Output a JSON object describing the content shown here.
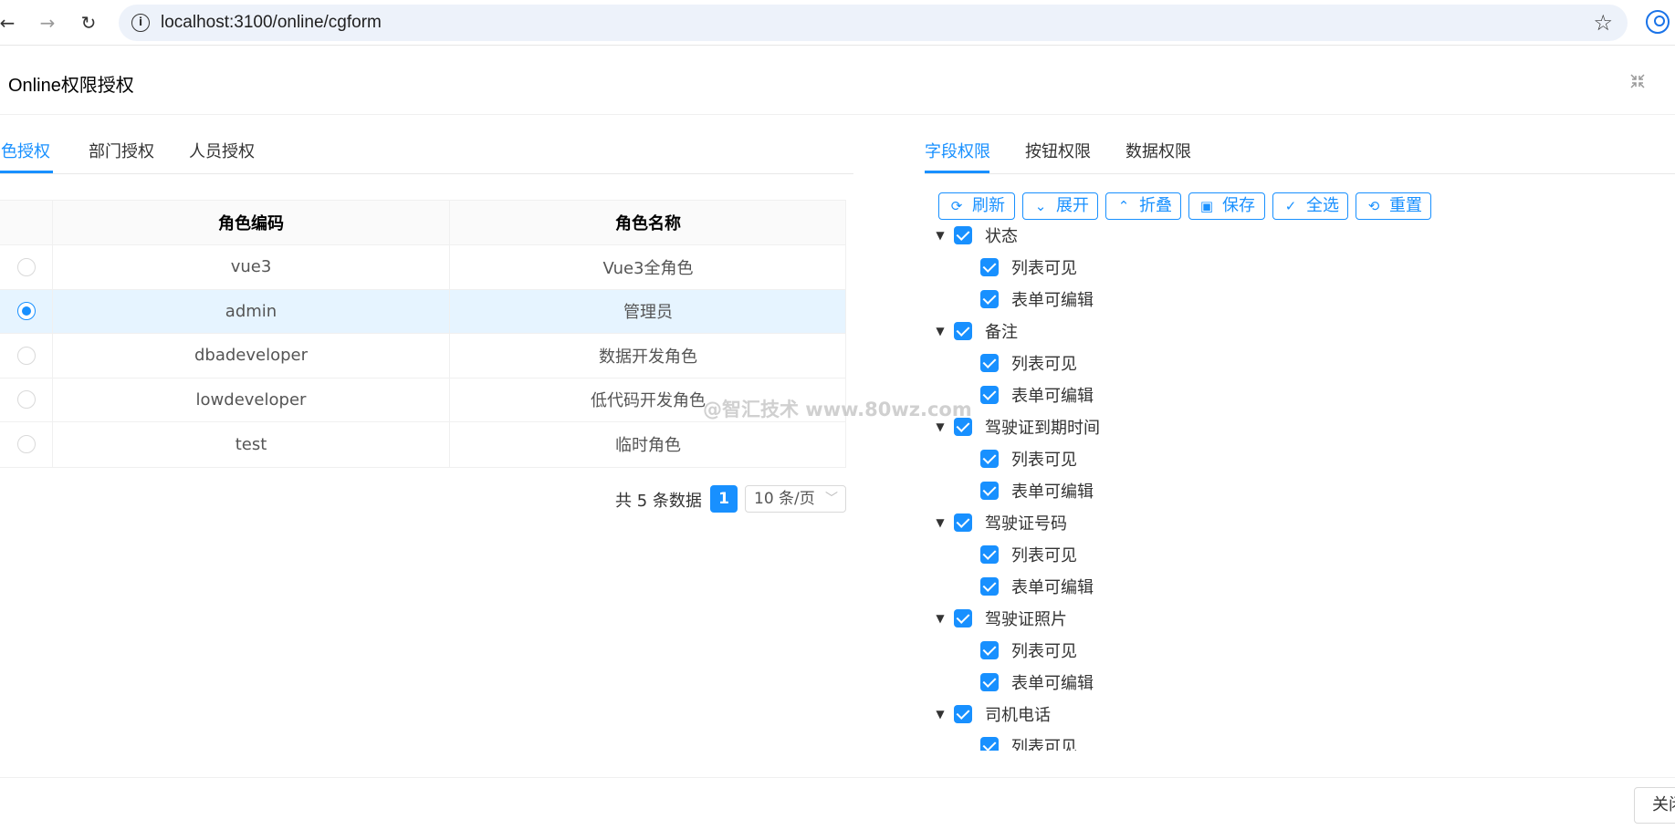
{
  "browser": {
    "url": "localhost:3100/online/cgform",
    "back": "←",
    "forward": "→",
    "reload": "↻",
    "star": "☆"
  },
  "modal": {
    "title": "Online权限授权",
    "fullscreen_icon": "⤡"
  },
  "left_tabs": [
    {
      "label": "角色授权",
      "active": true
    },
    {
      "label": "部门授权",
      "active": false
    },
    {
      "label": "人员授权",
      "active": false
    }
  ],
  "table": {
    "columns": [
      "角色编码",
      "角色名称"
    ],
    "rows": [
      {
        "code": "vue3",
        "name": "Vue3全角色",
        "selected": false
      },
      {
        "code": "admin",
        "name": "管理员",
        "selected": true
      },
      {
        "code": "dbadeveloper",
        "name": "数据开发角色",
        "selected": false
      },
      {
        "code": "lowdeveloper",
        "name": "低代码开发角色",
        "selected": false
      },
      {
        "code": "test",
        "name": "临时角色",
        "selected": false
      }
    ]
  },
  "pagination": {
    "total": "共 5 条数据",
    "current_page": "1",
    "page_size": "10 条/页"
  },
  "watermark": "@智汇技术  www.80wz.com",
  "right_tabs": [
    {
      "label": "字段权限",
      "active": true
    },
    {
      "label": "按钮权限",
      "active": false
    },
    {
      "label": "数据权限",
      "active": false
    }
  ],
  "toolbar": {
    "refresh": "刷新",
    "expand": "展开",
    "collapse": "折叠",
    "save": "保存",
    "select_all": "全选",
    "reset": "重置"
  },
  "tree": [
    {
      "label": "状态",
      "children": [
        "列表可见",
        "表单可编辑"
      ]
    },
    {
      "label": "备注",
      "children": [
        "列表可见",
        "表单可编辑"
      ]
    },
    {
      "label": "驾驶证到期时间",
      "children": [
        "列表可见",
        "表单可编辑"
      ]
    },
    {
      "label": "驾驶证号码",
      "children": [
        "列表可见",
        "表单可编辑"
      ]
    },
    {
      "label": "驾驶证照片",
      "children": [
        "列表可见",
        "表单可编辑"
      ]
    },
    {
      "label": "司机电话",
      "children": [
        "列表可见"
      ]
    }
  ],
  "footer": {
    "close": "关闭"
  },
  "colors": {
    "primary": "#1890ff",
    "selected_row": "#e6f4ff"
  }
}
